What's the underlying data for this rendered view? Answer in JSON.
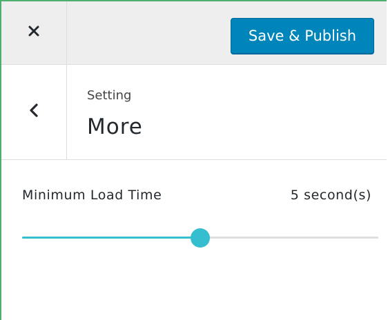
{
  "toolbar": {
    "close_icon": "close-icon",
    "publish_label": "Save & Publish"
  },
  "section": {
    "back_icon": "chevron-left-icon",
    "kicker": "Setting",
    "title": "More"
  },
  "control": {
    "label": "Minimum Load Time",
    "value_text": "5 second(s)",
    "slider_fraction": 0.5
  },
  "colors": {
    "accent": "#35bdd0",
    "publish_button": "#0085ba"
  }
}
